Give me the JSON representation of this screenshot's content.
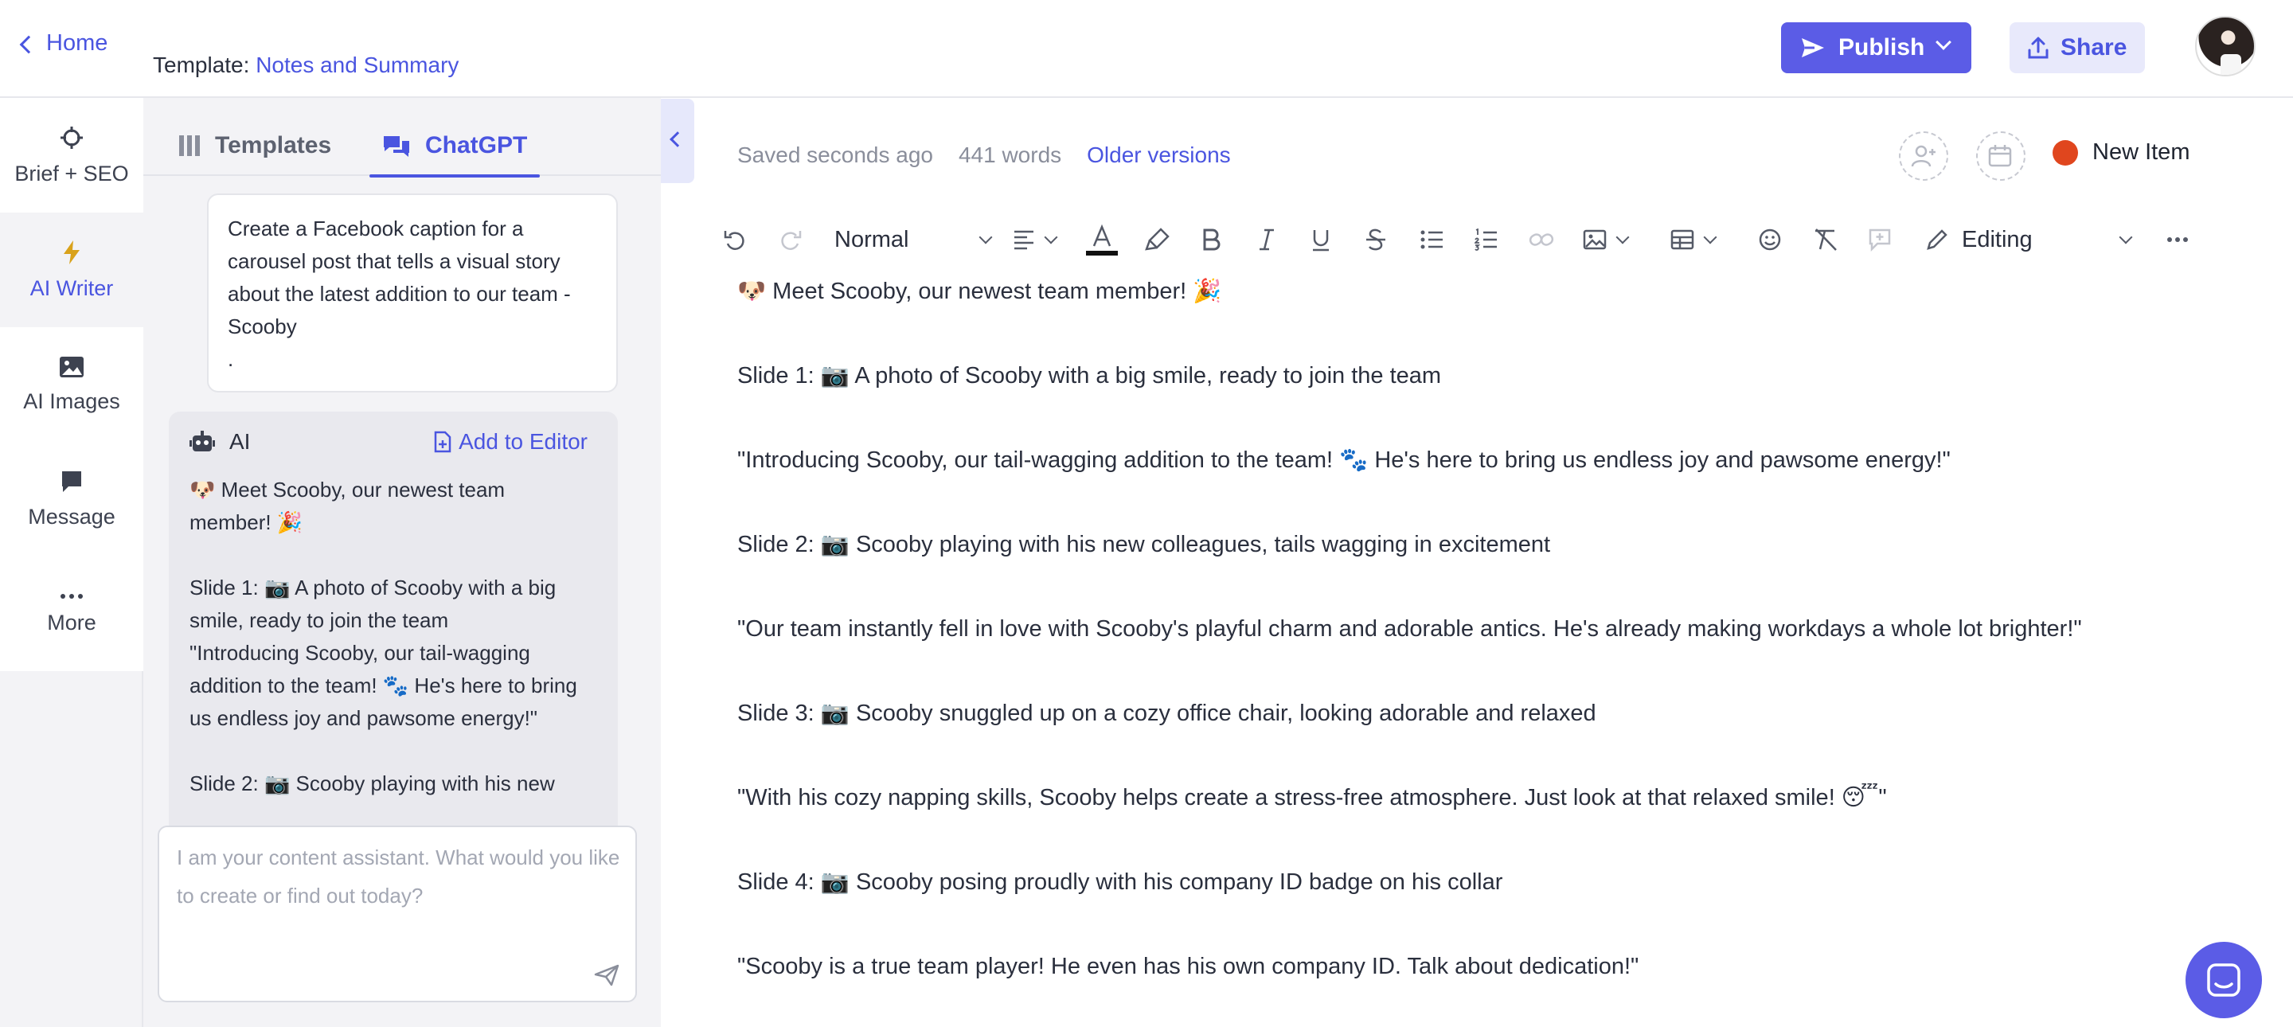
{
  "header": {
    "home_label": "Home",
    "template_prefix": "Template:",
    "template_name": "Notes and Summary",
    "publish_label": "Publish",
    "share_label": "Share"
  },
  "rail": {
    "items": [
      {
        "label": "Brief + SEO",
        "icon": "target-icon"
      },
      {
        "label": "AI Writer",
        "icon": "lightning-icon"
      },
      {
        "label": "AI Images",
        "icon": "image-icon"
      },
      {
        "label": "Message",
        "icon": "message-icon"
      },
      {
        "label": "More",
        "icon": "more-dots-icon"
      }
    ],
    "active": "AI Writer"
  },
  "panel": {
    "tabs": [
      {
        "label": "Templates",
        "icon": "templates-icon"
      },
      {
        "label": "ChatGPT",
        "icon": "chat-icon"
      }
    ],
    "active_tab": "ChatGPT",
    "user_message": "Create a Facebook caption for a carousel post that tells a visual story about the latest addition to our team - Scooby\n.",
    "ai_label": "AI",
    "add_to_editor_label": "Add to Editor",
    "ai_message": "🐶 Meet Scooby, our newest team member! 🎉\n\nSlide 1: 📷 A photo of Scooby with a big smile, ready to join the team\n\"Introducing Scooby, our tail-wagging addition to the team! 🐾 He's here to bring us endless joy and pawsome energy!\"\n\nSlide 2: 📷 Scooby playing with his new",
    "input_placeholder": "I am your content assistant. What would you like to create or find out today?"
  },
  "editor": {
    "saved_status": "Saved seconds ago",
    "word_count": "441 words",
    "older_versions": "Older versions",
    "item_status": "New Item",
    "status_color": "#e0461e",
    "toolbar": {
      "style_select": "Normal",
      "mode_select": "Editing"
    },
    "paragraphs": [
      "🐶 Meet Scooby, our newest team member! 🎉",
      "Slide 1: 📷 A photo of Scooby with a big smile, ready to join the team",
      "\"Introducing Scooby, our tail-wagging addition to the team! 🐾 He's here to bring us endless joy and pawsome energy!\"",
      "Slide 2: 📷 Scooby playing with his new colleagues, tails wagging in excitement",
      "\"Our team instantly fell in love with Scooby's playful charm and adorable antics. He's already making workdays a whole lot brighter!\"",
      "Slide 3: 📷 Scooby snuggled up on a cozy office chair, looking adorable and relaxed",
      "\"With his cozy napping skills, Scooby helps create a stress-free atmosphere. Just look at that relaxed smile! 😴\"",
      "Slide 4: 📷 Scooby posing proudly with his company ID badge on his collar",
      "\"Scooby is a true team player! He even has his own company ID. Talk about dedication!\""
    ]
  },
  "colors": {
    "accent": "#5b5ce6",
    "link": "#4a55e0"
  }
}
